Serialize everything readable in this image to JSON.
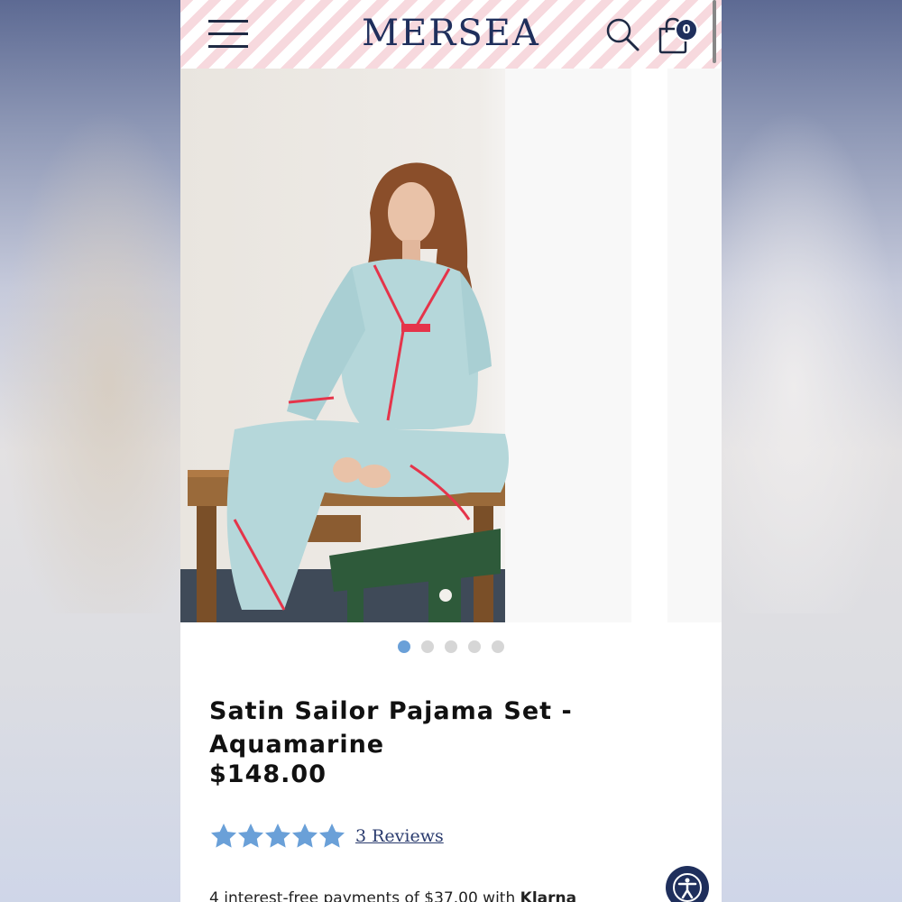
{
  "brand": {
    "logo_text": "MERSEA"
  },
  "header": {
    "menu_icon": "hamburger-menu-icon",
    "search_icon": "search-icon",
    "cart_icon": "shopping-bag-icon",
    "cart_count": "0"
  },
  "gallery": {
    "image_alt": "Model in aquamarine satin pajama set with red piping sitting on wooden table",
    "dots": [
      true,
      false,
      false,
      false,
      false
    ]
  },
  "product": {
    "title": "Satin Sailor Pajama Set - Aquamarine",
    "price": "$148.00",
    "rating": 5,
    "reviews_label": "3 Reviews",
    "klarna_text": "4 interest-free payments of $37.00 with ",
    "klarna_brand": "Klarna"
  },
  "accessibility": {
    "icon": "accessibility-icon"
  },
  "colors": {
    "brand_navy": "#1f2f5c",
    "stripe_pink": "#f7d9de",
    "star_blue": "#6aa0d8",
    "dot_active": "#6aa0d8",
    "pajama_aqua": "#b5d7da",
    "piping_red": "#e5344a"
  }
}
